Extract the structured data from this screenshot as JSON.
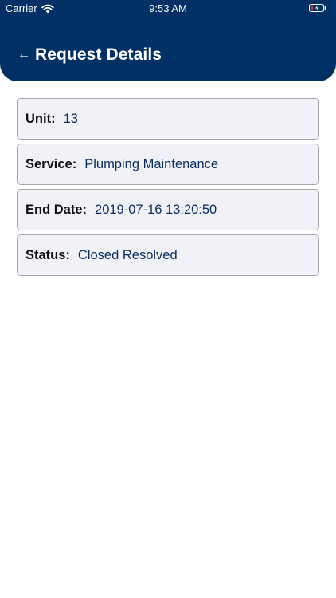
{
  "status_bar": {
    "carrier": "Carrier",
    "time": "9:53 AM",
    "wifi_icon": "wifi-icon",
    "battery_icon": "battery-icon"
  },
  "header": {
    "back_icon": "back-arrow-icon",
    "back_glyph": "←",
    "title": "Request Details",
    "background_color": "#003066"
  },
  "details": [
    {
      "label": "Unit:",
      "value": "13"
    },
    {
      "label": "Service:",
      "value": "Plumping Maintenance"
    },
    {
      "label": "End Date:",
      "value": "2019-07-16 13:20:50"
    },
    {
      "label": "Status:",
      "value": "Closed Resolved"
    }
  ],
  "colors": {
    "card_background": "#f1f1f8",
    "card_border": "#a7a7b4",
    "value_text": "#0b2d5e"
  }
}
